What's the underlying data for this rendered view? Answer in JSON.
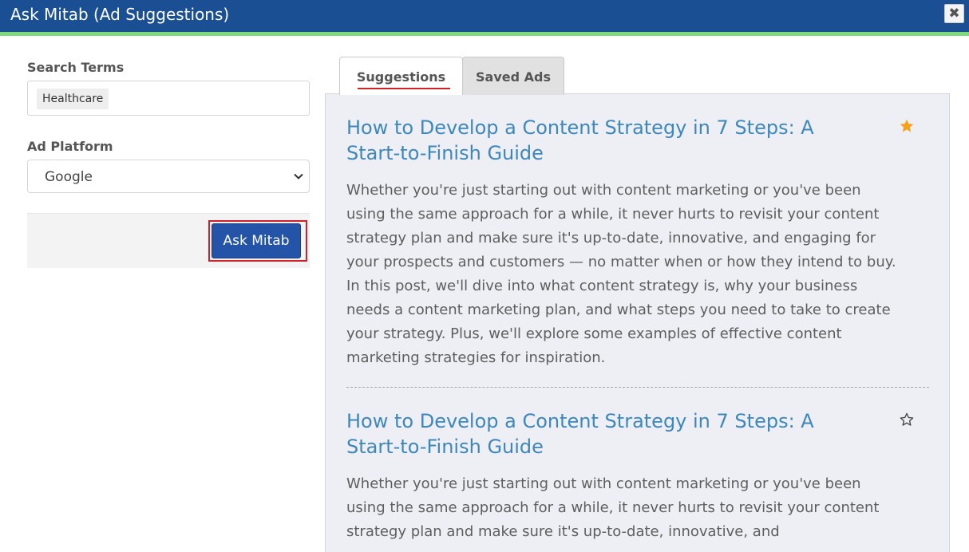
{
  "window": {
    "title": "Ask Mitab (Ad Suggestions)",
    "close_glyph": "✖"
  },
  "left_panel": {
    "search_label": "Search Terms",
    "search_tags": [
      "Healthcare"
    ],
    "platform_label": "Ad Platform",
    "platform_selected": "Google",
    "ask_button": "Ask Mitab"
  },
  "tabs": [
    {
      "label": "Suggestions",
      "active": true
    },
    {
      "label": "Saved Ads",
      "active": false
    }
  ],
  "suggestions": [
    {
      "headline": "How to Develop a Content Strategy in 7 Steps: A Start-to-Finish Guide",
      "body": "Whether you're just starting out with content marketing or you've been using the same approach for a while, it never hurts to revisit your content strategy plan and make sure it's up-to-date, innovative, and engaging for your prospects and customers — no matter when or how they intend to buy. In this post, we'll dive into what content strategy is, why your business needs a content marketing plan, and what steps you need to take to create your strategy. Plus, we'll explore some examples of effective content marketing strategies for inspiration.",
      "saved": true,
      "icon": "star-filled-icon"
    },
    {
      "headline": "How to Develop a Content Strategy in 7 Steps: A Start-to-Finish Guide",
      "body": "Whether you're just starting out with content marketing or you've been using the same approach for a while, it never hurts to revisit your content strategy plan and make sure it's up-to-date, innovative, and",
      "saved": false,
      "icon": "star-outline-icon"
    }
  ],
  "colors": {
    "titlebar": "#1b4f93",
    "accent_line": "#7fd97f",
    "link": "#3d87bd",
    "button": "#2454a7",
    "highlight": "#d0202a",
    "star": "#f7a11a"
  }
}
